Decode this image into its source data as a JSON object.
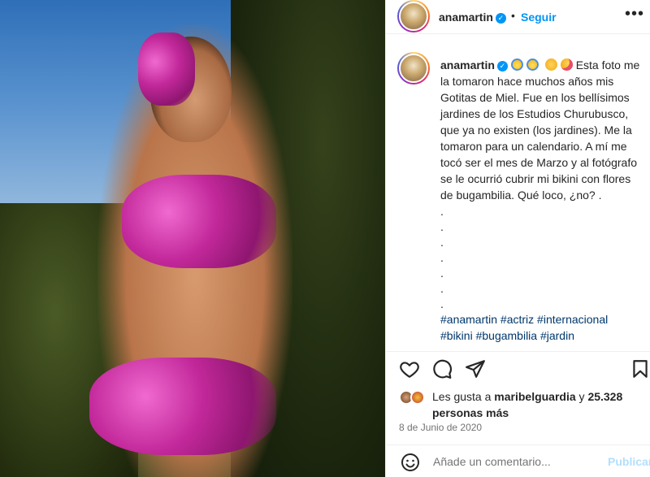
{
  "post": {
    "image_alt": "Foto de mujer con bikini de flores de bugambilia"
  },
  "header": {
    "username": "anamartin",
    "separator": "•",
    "follow_label": "Seguir",
    "more_icon": "more-horizontal-icon"
  },
  "caption": {
    "username": "anamartin",
    "emojis": [
      "face-screaming-icon",
      "face-screaming-icon",
      "smiling-face-icon",
      "kissing-face-icon"
    ],
    "text": "Esta foto me la tomaron hace muchos años mis Gotitas de Miel. Fue en los bellísimos jardines de los Estudios Churubusco, que ya no existen (los jardines). Me la tomaron para un calendario. A mí me tocó ser el mes de Marzo y al fotógrafo se le ocurrió cubrir mi bikini con flores de bugambilia. Qué loco, ¿no? .",
    "dots": [
      ".",
      ".",
      ".",
      ".",
      ".",
      ".",
      "."
    ],
    "hashtags_line1": "#anamartin #actriz #internacional",
    "hashtags_line2": "#bikini #bugambilia #jardin"
  },
  "actions": {
    "like_icon": "heart-icon",
    "comment_icon": "comment-icon",
    "share_icon": "share-icon",
    "save_icon": "bookmark-icon"
  },
  "likes": {
    "prefix": "Les gusta a",
    "user": "maribelguardia",
    "conj": "y",
    "count": "25.328",
    "suffix": "personas más"
  },
  "date": "8 de Junio de 2020",
  "comment": {
    "placeholder": "Añade un comentario...",
    "publish_label": "Publicar"
  },
  "colors": {
    "accent": "#0095f6",
    "hashtag": "#00376b",
    "muted": "#737373",
    "publish_disabled": "#b2dffc"
  }
}
